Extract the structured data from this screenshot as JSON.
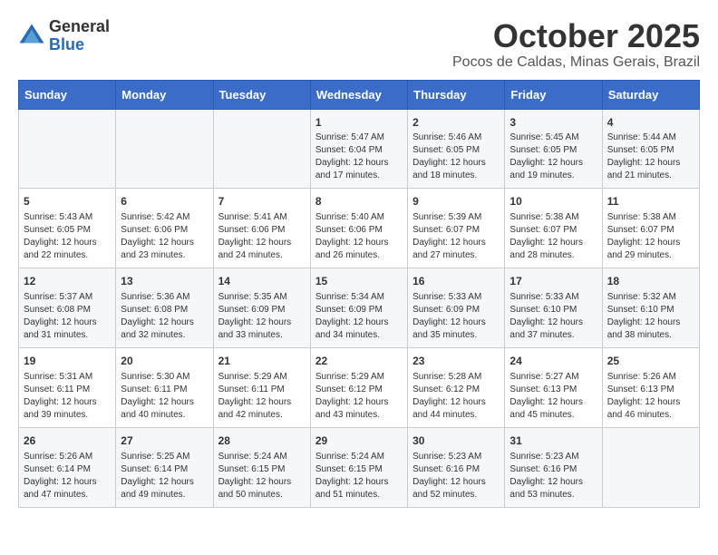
{
  "header": {
    "logo_line1": "General",
    "logo_line2": "Blue",
    "month": "October 2025",
    "location": "Pocos de Caldas, Minas Gerais, Brazil"
  },
  "weekdays": [
    "Sunday",
    "Monday",
    "Tuesday",
    "Wednesday",
    "Thursday",
    "Friday",
    "Saturday"
  ],
  "weeks": [
    [
      {
        "day": "",
        "info": ""
      },
      {
        "day": "",
        "info": ""
      },
      {
        "day": "",
        "info": ""
      },
      {
        "day": "1",
        "info": "Sunrise: 5:47 AM\nSunset: 6:04 PM\nDaylight: 12 hours and 17 minutes."
      },
      {
        "day": "2",
        "info": "Sunrise: 5:46 AM\nSunset: 6:05 PM\nDaylight: 12 hours and 18 minutes."
      },
      {
        "day": "3",
        "info": "Sunrise: 5:45 AM\nSunset: 6:05 PM\nDaylight: 12 hours and 19 minutes."
      },
      {
        "day": "4",
        "info": "Sunrise: 5:44 AM\nSunset: 6:05 PM\nDaylight: 12 hours and 21 minutes."
      }
    ],
    [
      {
        "day": "5",
        "info": "Sunrise: 5:43 AM\nSunset: 6:05 PM\nDaylight: 12 hours and 22 minutes."
      },
      {
        "day": "6",
        "info": "Sunrise: 5:42 AM\nSunset: 6:06 PM\nDaylight: 12 hours and 23 minutes."
      },
      {
        "day": "7",
        "info": "Sunrise: 5:41 AM\nSunset: 6:06 PM\nDaylight: 12 hours and 24 minutes."
      },
      {
        "day": "8",
        "info": "Sunrise: 5:40 AM\nSunset: 6:06 PM\nDaylight: 12 hours and 26 minutes."
      },
      {
        "day": "9",
        "info": "Sunrise: 5:39 AM\nSunset: 6:07 PM\nDaylight: 12 hours and 27 minutes."
      },
      {
        "day": "10",
        "info": "Sunrise: 5:38 AM\nSunset: 6:07 PM\nDaylight: 12 hours and 28 minutes."
      },
      {
        "day": "11",
        "info": "Sunrise: 5:38 AM\nSunset: 6:07 PM\nDaylight: 12 hours and 29 minutes."
      }
    ],
    [
      {
        "day": "12",
        "info": "Sunrise: 5:37 AM\nSunset: 6:08 PM\nDaylight: 12 hours and 31 minutes."
      },
      {
        "day": "13",
        "info": "Sunrise: 5:36 AM\nSunset: 6:08 PM\nDaylight: 12 hours and 32 minutes."
      },
      {
        "day": "14",
        "info": "Sunrise: 5:35 AM\nSunset: 6:09 PM\nDaylight: 12 hours and 33 minutes."
      },
      {
        "day": "15",
        "info": "Sunrise: 5:34 AM\nSunset: 6:09 PM\nDaylight: 12 hours and 34 minutes."
      },
      {
        "day": "16",
        "info": "Sunrise: 5:33 AM\nSunset: 6:09 PM\nDaylight: 12 hours and 35 minutes."
      },
      {
        "day": "17",
        "info": "Sunrise: 5:33 AM\nSunset: 6:10 PM\nDaylight: 12 hours and 37 minutes."
      },
      {
        "day": "18",
        "info": "Sunrise: 5:32 AM\nSunset: 6:10 PM\nDaylight: 12 hours and 38 minutes."
      }
    ],
    [
      {
        "day": "19",
        "info": "Sunrise: 5:31 AM\nSunset: 6:11 PM\nDaylight: 12 hours and 39 minutes."
      },
      {
        "day": "20",
        "info": "Sunrise: 5:30 AM\nSunset: 6:11 PM\nDaylight: 12 hours and 40 minutes."
      },
      {
        "day": "21",
        "info": "Sunrise: 5:29 AM\nSunset: 6:11 PM\nDaylight: 12 hours and 42 minutes."
      },
      {
        "day": "22",
        "info": "Sunrise: 5:29 AM\nSunset: 6:12 PM\nDaylight: 12 hours and 43 minutes."
      },
      {
        "day": "23",
        "info": "Sunrise: 5:28 AM\nSunset: 6:12 PM\nDaylight: 12 hours and 44 minutes."
      },
      {
        "day": "24",
        "info": "Sunrise: 5:27 AM\nSunset: 6:13 PM\nDaylight: 12 hours and 45 minutes."
      },
      {
        "day": "25",
        "info": "Sunrise: 5:26 AM\nSunset: 6:13 PM\nDaylight: 12 hours and 46 minutes."
      }
    ],
    [
      {
        "day": "26",
        "info": "Sunrise: 5:26 AM\nSunset: 6:14 PM\nDaylight: 12 hours and 47 minutes."
      },
      {
        "day": "27",
        "info": "Sunrise: 5:25 AM\nSunset: 6:14 PM\nDaylight: 12 hours and 49 minutes."
      },
      {
        "day": "28",
        "info": "Sunrise: 5:24 AM\nSunset: 6:15 PM\nDaylight: 12 hours and 50 minutes."
      },
      {
        "day": "29",
        "info": "Sunrise: 5:24 AM\nSunset: 6:15 PM\nDaylight: 12 hours and 51 minutes."
      },
      {
        "day": "30",
        "info": "Sunrise: 5:23 AM\nSunset: 6:16 PM\nDaylight: 12 hours and 52 minutes."
      },
      {
        "day": "31",
        "info": "Sunrise: 5:23 AM\nSunset: 6:16 PM\nDaylight: 12 hours and 53 minutes."
      },
      {
        "day": "",
        "info": ""
      }
    ]
  ]
}
